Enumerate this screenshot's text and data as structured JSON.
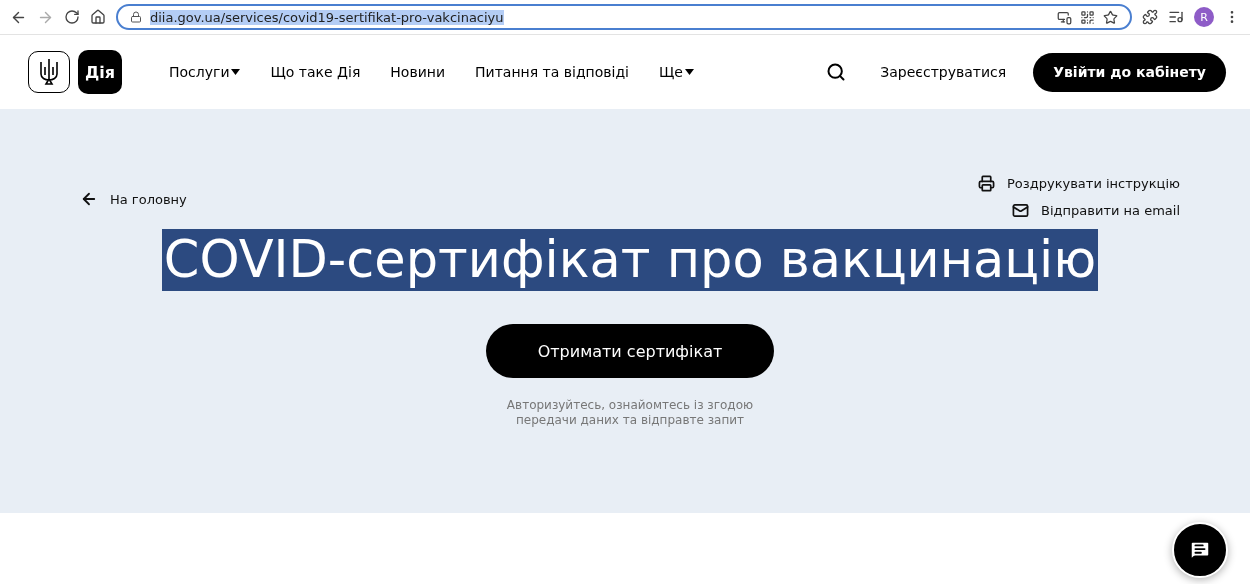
{
  "browser": {
    "url": "diia.gov.ua/services/covid19-sertifikat-pro-vakcinaciyu",
    "url_highlighted": true,
    "avatar": "R"
  },
  "header": {
    "logo": "Дія",
    "nav": [
      {
        "label": "Послуги",
        "has_menu": true
      },
      {
        "label": "Що таке Дія",
        "has_menu": false
      },
      {
        "label": "Новини",
        "has_menu": false
      },
      {
        "label": "Питання та відповіді",
        "has_menu": false
      },
      {
        "label": "Ще",
        "has_menu": true
      }
    ],
    "register": "Зареєструватися",
    "login": "Увійти до кабінету"
  },
  "hero": {
    "back": "На головну",
    "actions": [
      {
        "kind": "print",
        "label": "Роздрукувати інструкцію"
      },
      {
        "kind": "email",
        "label": "Відправити на email"
      }
    ],
    "title": "COVID-сертифікат про вакцинацію",
    "title_highlighted": true,
    "cta": "Отримати сертифікат",
    "note": [
      "Авторизуйтесь, ознайомтесь із згодою",
      "передачи даних та відправте запит"
    ]
  }
}
